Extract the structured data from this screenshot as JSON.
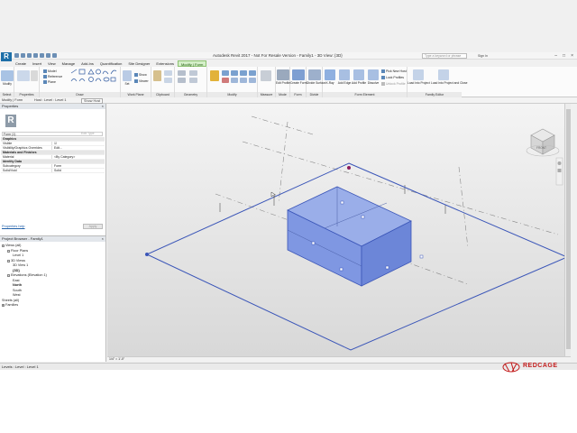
{
  "titlebar": {
    "title": "Autodesk Revit 2017 - Not For Resale Version -    Family1 - 3D View: {3D}",
    "app_button": "R",
    "search_placeholder": "Type a keyword or phrase",
    "signin": "Sign In"
  },
  "ribbon_tabs": [
    {
      "label": "Create"
    },
    {
      "label": "Insert"
    },
    {
      "label": "View"
    },
    {
      "label": "Manage"
    },
    {
      "label": "Add-Ins"
    },
    {
      "label": "Quantification"
    },
    {
      "label": "Site Designer"
    },
    {
      "label": "Extensions"
    },
    {
      "label": "Modify | Form"
    }
  ],
  "ribbon": {
    "modify_label": "Modify",
    "draw_tools": {
      "model": "Model",
      "reference": "Reference",
      "plane": "Plane"
    },
    "workplane": {
      "set": "Set",
      "show": "Show",
      "viewer": "Viewer"
    },
    "form": {
      "edit_profile": "Edit Profile",
      "create_form": "Create Form",
      "divide_surface": "Divide Surface",
      "xray": "X-Ray",
      "add_edge": "Add Edge",
      "add_profile": "Add Profile",
      "dissolve": "Dissolve",
      "pick_new_host": "Pick New Host",
      "lock_profiles": "Lock Profiles",
      "unlock_profile": "Unlock Profile"
    },
    "family_editor": {
      "load_project": "Load into Project",
      "load_close": "Load into Project and Close"
    },
    "panels": [
      "Select",
      "Properties",
      "Draw",
      "Work Plane",
      "Clipboard",
      "Geometry",
      "Modify",
      "Measure",
      "Mode",
      "Form",
      "Divide",
      "Form Element",
      "Family Editor"
    ]
  },
  "optionbar": {
    "context": "Modify | Form",
    "host": "Host : Level : Level 1",
    "show_host": "Show Host"
  },
  "properties": {
    "title": "Properties",
    "close": "×",
    "type": "Form (1)",
    "edit_type": "Edit Type",
    "rows": [
      {
        "k": "Graphics",
        "v": "",
        "group": true
      },
      {
        "k": "Visible",
        "v": "☑",
        "group": false
      },
      {
        "k": "Visibility/Graphics Overrides",
        "v": "Edit...",
        "group": false
      },
      {
        "k": "Materials and Finishes",
        "v": "",
        "group": true
      },
      {
        "k": "Material",
        "v": "<By Category>",
        "group": false
      },
      {
        "k": "Identity Data",
        "v": "",
        "group": true
      },
      {
        "k": "Subcategory",
        "v": "Form",
        "group": false
      },
      {
        "k": "Solid/Void",
        "v": "Solid",
        "group": false
      }
    ],
    "help": "Properties help",
    "apply": "Apply"
  },
  "browser": {
    "title": "Project Browser - Family1",
    "close": "×",
    "items": [
      {
        "label": "Views (all)",
        "indent": 0,
        "toggle": "-",
        "bold": false
      },
      {
        "label": "Floor Plans",
        "indent": 1,
        "toggle": "-",
        "bold": false
      },
      {
        "label": "Level 1",
        "indent": 2,
        "toggle": "",
        "bold": false
      },
      {
        "label": "3D Views",
        "indent": 1,
        "toggle": "-",
        "bold": false
      },
      {
        "label": "3D View 1",
        "indent": 2,
        "toggle": "",
        "bold": false
      },
      {
        "label": "{3D}",
        "indent": 2,
        "toggle": "",
        "bold": true
      },
      {
        "label": "Elevations (Elevation 1)",
        "indent": 1,
        "toggle": "-",
        "bold": false
      },
      {
        "label": "East",
        "indent": 2,
        "toggle": "",
        "bold": false
      },
      {
        "label": "North",
        "indent": 2,
        "toggle": "",
        "bold": true
      },
      {
        "label": "South",
        "indent": 2,
        "toggle": "",
        "bold": false
      },
      {
        "label": "West",
        "indent": 2,
        "toggle": "",
        "bold": false
      },
      {
        "label": "Sheets (all)",
        "indent": 0,
        "toggle": "",
        "bold": false
      },
      {
        "label": "Families",
        "indent": 0,
        "toggle": "+",
        "bold": false
      }
    ]
  },
  "viewbar": {
    "scale": "1/4\" = 1'-0\""
  },
  "status": {
    "text": "Levels : Level : Level 1"
  },
  "viewcube": {
    "face": "FRONT"
  },
  "brand": {
    "name": "REDCAGE"
  },
  "colors": {
    "form_fill": "#7f97e2",
    "form_edge": "#3b56b8",
    "context_tab": "#d5efc9",
    "brand": "#c21b1b"
  }
}
